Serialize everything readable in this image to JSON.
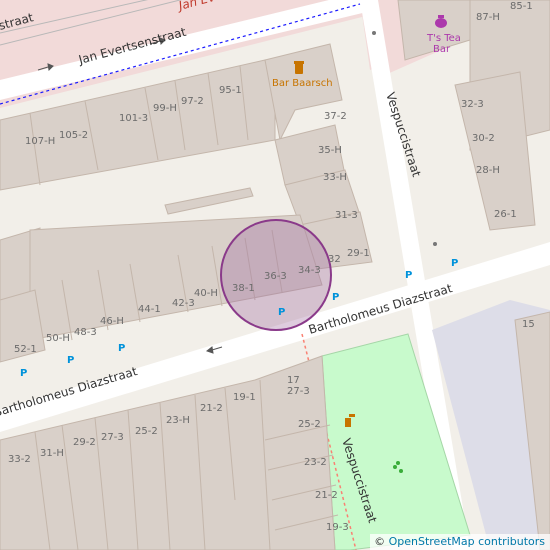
{
  "map": {
    "streets": {
      "jan_evertsenstraat": "Jan Evertsenstraat",
      "jan_evertsenstraat_partial": "Jan Eve",
      "straat_partial_top_left": "straat",
      "vespuccistraat_north": "Vespuccistraat",
      "vespuccistraat_south": "Vespuccistraat",
      "bartholomeus_east": "Bartholomeus Diazstraat",
      "bartholomeus_west": "Bartholomeus Diazstraat"
    },
    "pois": {
      "bar_baarsch": "Bar Baarsch",
      "ts_tea_bar_line1": "T's Tea",
      "ts_tea_bar_line2": "Bar"
    },
    "colors": {
      "background": "#f2efe9",
      "building": "#d9d0c9",
      "building_stroke": "#c4b6ab",
      "road": "#ffffff",
      "pedestrian": "#dddde8",
      "pink_area": "#f2dad9",
      "park": "#c8facc",
      "tram_dashes": "#0000ff",
      "marker_fill": "#a06ea0",
      "marker_stroke": "#8a3a8a",
      "parking_icon": "#0092da",
      "tea_icon": "#ac39ac",
      "food_icon": "#c77400"
    },
    "house_numbers": {
      "n85_1": "85-1",
      "n87_h": "87-H",
      "n95_1": "95-1",
      "n97_2": "97-2",
      "n99_h": "99-H",
      "n101_3": "101-3",
      "n105_2": "105-2",
      "n107_h": "107-H",
      "n37_2": "37-2",
      "n35_h": "35-H",
      "n33_h": "33-H",
      "n31_3": "31-3",
      "n29_1": "29-1",
      "n32": "32",
      "n34_3": "34-3",
      "n36_3": "36-3",
      "n38_1": "38-1",
      "n40_h": "40-H",
      "n42_3": "42-3",
      "n44_1": "44-1",
      "n46_h": "46-H",
      "n48_3": "48-3",
      "n50_h": "50-H",
      "n52_1": "52-1",
      "n32_3": "32-3",
      "n30_2": "30-2",
      "n28_h": "28-H",
      "n26_1": "26-1",
      "n15": "15",
      "n17": "17",
      "n27_3": "27-3",
      "n25_2_right": "25-2",
      "n23_2": "23-2",
      "n21_2_right": "21-2",
      "n19_3": "19-3",
      "n19_1": "19-1",
      "n21_2": "21-2",
      "n23_h": "23-H",
      "n25_2": "25-2",
      "n27_3_left": "27-3",
      "n29_2": "29-2",
      "n31_h": "31-H",
      "n33_2": "33-2"
    },
    "attribution": {
      "copyright": "©",
      "text": "OpenStreetMap contributors"
    }
  }
}
